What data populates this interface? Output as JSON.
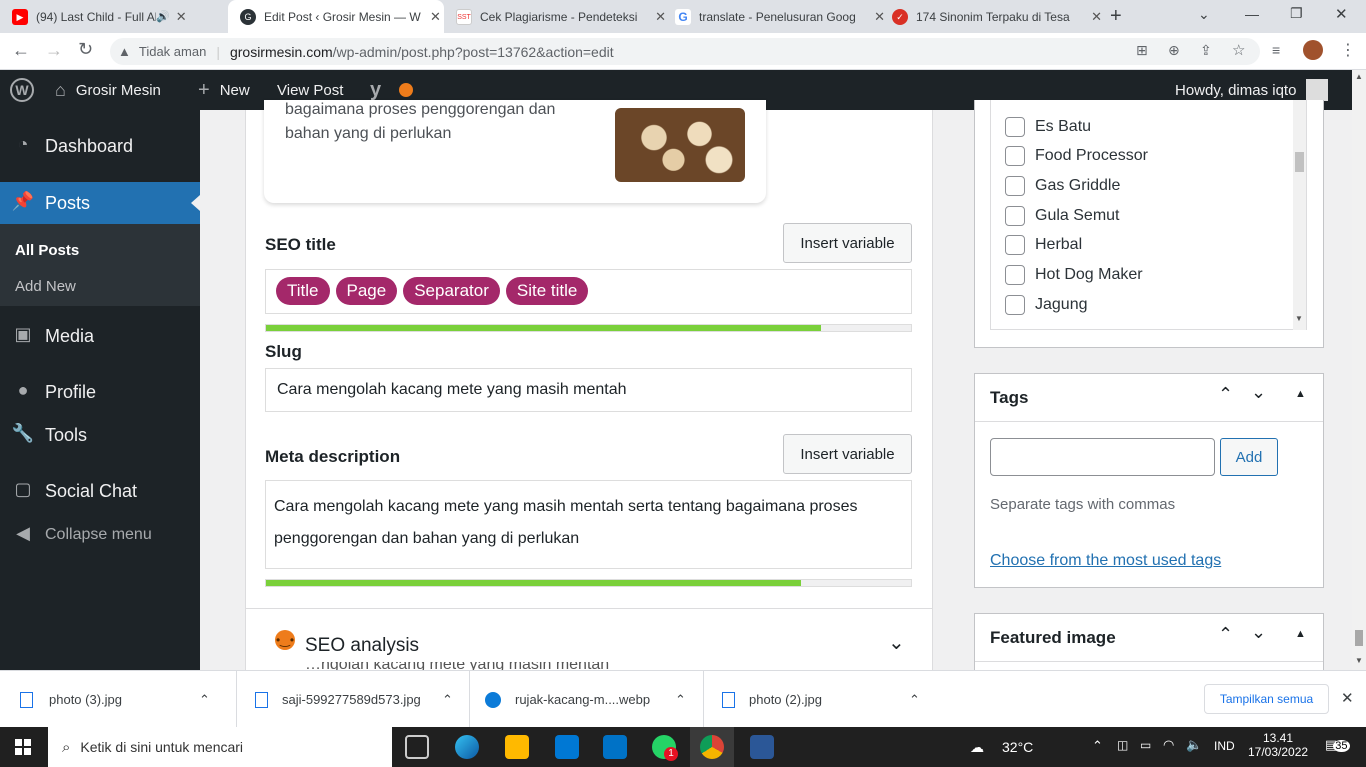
{
  "browser": {
    "tabs": [
      {
        "title": "(94) Last Child - Full Albu",
        "favicon": "youtube-icon",
        "color": "#ff0000"
      },
      {
        "title": "Edit Post ‹ Grosir Mesin — W",
        "favicon": "wordpress-icon",
        "color": "#2c3338",
        "active": true
      },
      {
        "title": "Cek Plagiarisme - Pendeteksi",
        "favicon": "sst-icon",
        "color": "#e33"
      },
      {
        "title": "translate - Penelusuran Goog",
        "favicon": "google-icon",
        "color": "#4285f4"
      },
      {
        "title": "174 Sinonim Terpaku di Tesa",
        "favicon": "check-icon",
        "color": "#d93025"
      }
    ],
    "security_label": "Tidak aman",
    "url_host": "grosirmesin.com",
    "url_path": "/wp-admin/post.php?post=13762&action=edit"
  },
  "adminbar": {
    "site": "Grosir Mesin",
    "new": "New",
    "view_post": "View Post",
    "howdy": "Howdy, dimas iqto"
  },
  "sidebar": {
    "dashboard": "Dashboard",
    "posts": "Posts",
    "all_posts": "All Posts",
    "add_new": "Add New",
    "media": "Media",
    "profile": "Profile",
    "tools": "Tools",
    "social_chat": "Social Chat",
    "collapse": "Collapse menu"
  },
  "preview": {
    "snippet_line1": "bagaimana proses penggorengan dan",
    "snippet_line2": "bahan yang di perlukan"
  },
  "seo": {
    "seo_title_label": "SEO title",
    "insert_variable": "Insert variable",
    "pills": [
      "Title",
      "Page",
      "Separator",
      "Site title"
    ],
    "title_progress": 0.86,
    "slug_label": "Slug",
    "slug_value": "Cara mengolah kacang mete yang masih mentah",
    "meta_label": "Meta description",
    "meta_line1": "Cara mengolah kacang mete yang masih mentah serta tentang bagaimana proses",
    "meta_line2": "penggorengan dan bahan yang di perlukan",
    "meta_progress": 0.83,
    "analysis_label": "SEO analysis",
    "analysis_sub": "…ngolah kacang mete yang masih mentah"
  },
  "categories": [
    "Es Batu",
    "Food Processor",
    "Gas Griddle",
    "Gula Semut",
    "Herbal",
    "Hot Dog Maker",
    "Jagung"
  ],
  "tags": {
    "title": "Tags",
    "add": "Add",
    "hint": "Separate tags with commas",
    "choose": "Choose from the most used tags"
  },
  "featured": {
    "title": "Featured image"
  },
  "downloads": {
    "items": [
      "photo (3).jpg",
      "saji-599277589d573.jpg",
      "rujak-kacang-m....webp",
      "photo (2).jpg"
    ],
    "show_all": "Tampilkan semua"
  },
  "taskbar": {
    "search": "Ketik di sini untuk mencari",
    "weather": "32°C",
    "lang": "IND",
    "time": "13.41",
    "date": "17/03/2022",
    "notif": "35",
    "whatsapp_badge": "1"
  }
}
